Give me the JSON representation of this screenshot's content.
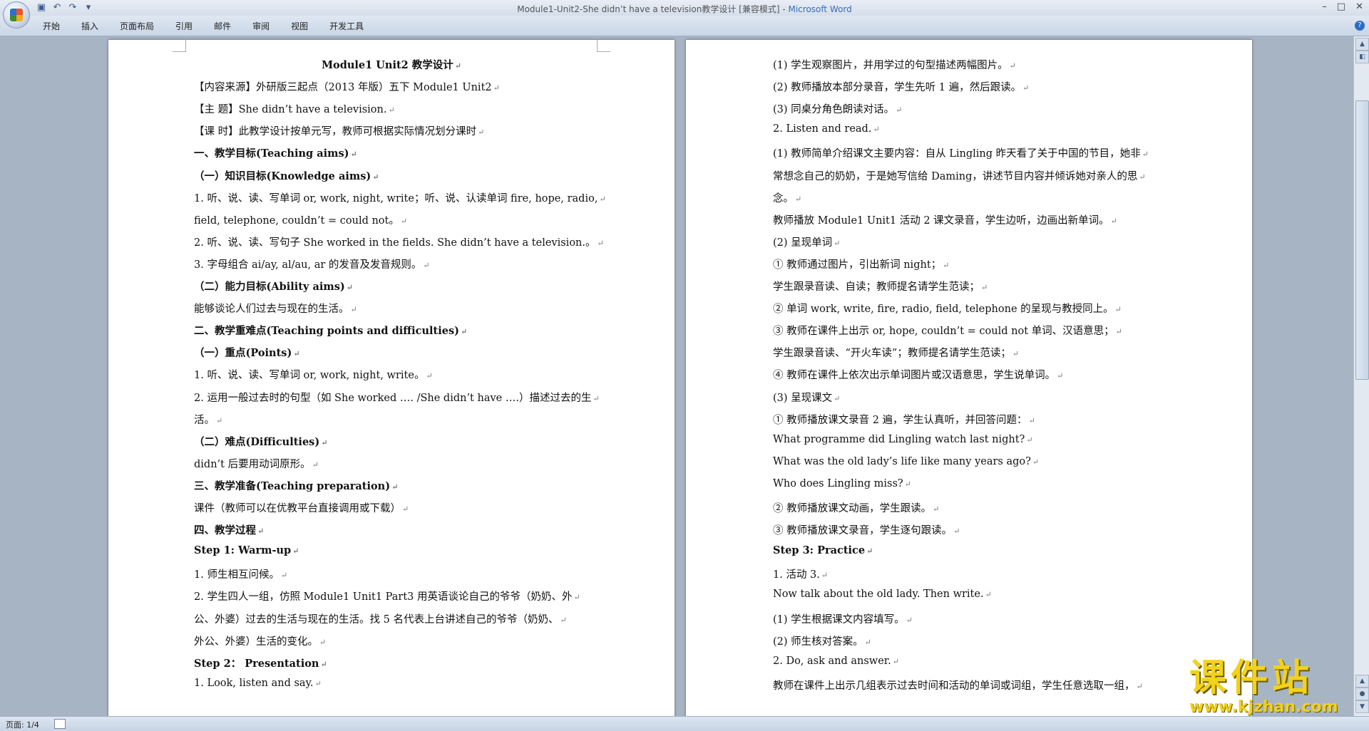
{
  "window": {
    "title": "Module1-Unit2-She didn’t have a television教学设计 [兼容模式] - ",
    "app_name": "Microsoft Word"
  },
  "ribbon": {
    "tabs": [
      "开始",
      "插入",
      "页面布局",
      "引用",
      "邮件",
      "审阅",
      "视图",
      "开发工具"
    ]
  },
  "page1": {
    "lines": [
      {
        "text": "Module1 Unit2  教学设计",
        "bold": true,
        "center": true
      },
      {
        "text": "【内容来源】外研版三起点（2013 年版）五下 Module1 Unit2"
      },
      {
        "text": "【主      题】She didn’t have a television."
      },
      {
        "text": "【课      时】此教学设计按单元写，教师可根据实际情况划分课时"
      },
      {
        "text": "一、教学目标(Teaching aims)",
        "bold": true
      },
      {
        "text": "（一）知识目标(Knowledge aims)",
        "bold": true
      },
      {
        "text": "1. 听、说、读、写单词 or, work, night, write；听、说、认读单词 fire, hope, radio,"
      },
      {
        "text": "field, telephone, couldn’t = could not。"
      },
      {
        "text": "2. 听、说、读、写句子 She worked in the fields. She didn’t have a television.。"
      },
      {
        "text": "3. 字母组合 ai/ay, al/au, ar 的发音及发音规则。"
      },
      {
        "text": "（二）能力目标(Ability aims)",
        "bold": true
      },
      {
        "text": "能够谈论人们过去与现在的生活。"
      },
      {
        "text": "二、教学重难点(Teaching points and difficulties)",
        "bold": true
      },
      {
        "text": "（一）重点(Points)",
        "bold": true
      },
      {
        "text": "1. 听、说、读、写单词 or, work, night, write。"
      },
      {
        "text": "2. 运用一般过去时的句型（如 She worked …. /She didn’t have ….）描述过去的生"
      },
      {
        "text": "活。"
      },
      {
        "text": "（二）难点(Difficulties)",
        "bold": true
      },
      {
        "text": "didn’t 后要用动词原形。"
      },
      {
        "text": "三、教学准备(Teaching preparation)",
        "bold": true
      },
      {
        "text": "课件（教师可以在优教平台直接调用或下载）"
      },
      {
        "text": "四、教学过程",
        "bold": true
      },
      {
        "text": "Step 1: Warm-up",
        "bold": true
      },
      {
        "text": "1. 师生相互问候。"
      },
      {
        "text": "2. 学生四人一组，仿照 Module1 Unit1 Part3 用英语谈论自己的爷爷（奶奶、外"
      },
      {
        "text": "公、外婆）过去的生活与现在的生活。找 5 名代表上台讲述自己的爷爷（奶奶、"
      },
      {
        "text": "外公、外婆）生活的变化。"
      },
      {
        "text": "Step 2： Presentation",
        "bold": true
      },
      {
        "text": "1. Look, listen and say."
      }
    ]
  },
  "page2": {
    "lines": [
      {
        "text": "(1) 学生观察图片，并用学过的句型描述两幅图片。"
      },
      {
        "text": "(2) 教师播放本部分录音，学生先听 1 遍，然后跟读。"
      },
      {
        "text": "(3) 同桌分角色朗读对话。"
      },
      {
        "text": "2. Listen and read."
      },
      {
        "text": "(1) 教师简单介绍课文主要内容：自从 Lingling 昨天看了关于中国的节目，她非"
      },
      {
        "text": "常想念自己的奶奶，于是她写信给 Daming，讲述节目内容并倾诉她对亲人的思"
      },
      {
        "text": "念。"
      },
      {
        "text": "教师播放 Module1 Unit1 活动 2 课文录音，学生边听，边画出新单词。"
      },
      {
        "text": "(2) 呈现单词"
      },
      {
        "text": "① 教师通过图片，引出新词 night；"
      },
      {
        "text": "学生跟录音读、自读；教师提名请学生范读；"
      },
      {
        "text": "② 单词 work, write, fire, radio, field, telephone 的呈现与教授同上。"
      },
      {
        "text": "③ 教师在课件上出示 or, hope, couldn’t = could not 单词、汉语意思；"
      },
      {
        "text": "学生跟录音读、“开火车读”；教师提名请学生范读；"
      },
      {
        "text": "④ 教师在课件上依次出示单词图片或汉语意思，学生说单词。"
      },
      {
        "text": "(3) 呈现课文"
      },
      {
        "text": "① 教师播放课文录音 2 遍，学生认真听，并回答问题："
      },
      {
        "text": "What programme did Lingling watch last night?"
      },
      {
        "text": "What was the old lady’s life like many years ago?"
      },
      {
        "text": "Who does Lingling miss?"
      },
      {
        "text": "② 教师播放课文动画，学生跟读。"
      },
      {
        "text": "③ 教师播放课文录音，学生逐句跟读。"
      },
      {
        "text": "Step 3: Practice",
        "bold": true
      },
      {
        "text": "1. 活动 3."
      },
      {
        "text": "Now talk about the old lady. Then write."
      },
      {
        "text": "(1) 学生根据课文内容填写。"
      },
      {
        "text": "(2) 师生核对答案。"
      },
      {
        "text": "2. Do, ask and answer."
      },
      {
        "text": "教师在课件上出示几组表示过去时间和活动的单词或词组，学生任意选取一组，"
      }
    ]
  },
  "status": {
    "page_label": "页面: 1/4"
  },
  "watermark": {
    "big": "课件站",
    "url": "www.kjzhan.com"
  }
}
